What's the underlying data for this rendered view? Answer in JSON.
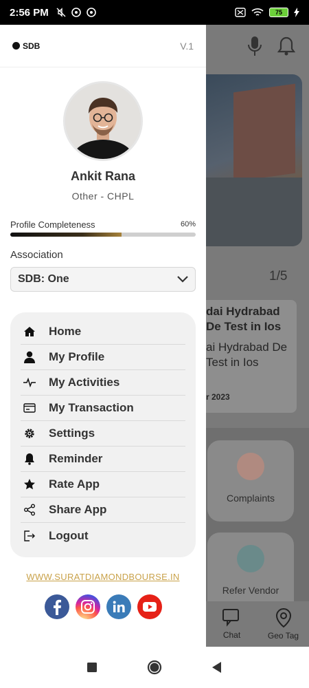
{
  "status_bar": {
    "time": "2:56 PM",
    "battery": "75"
  },
  "drawer": {
    "logo_text": "SDB",
    "version": "V.1",
    "user": {
      "name": "Ankit Rana",
      "role": "Other - CHPL"
    },
    "profile_completeness": {
      "label": "Profile Completeness",
      "percent_text": "60%",
      "value": 0.6
    },
    "association": {
      "label": "Association",
      "selected": "SDB: One"
    },
    "menu": [
      {
        "label": "Home",
        "icon": "home-icon"
      },
      {
        "label": "My Profile",
        "icon": "person-icon"
      },
      {
        "label": "My Activities",
        "icon": "activity-pulse-icon"
      },
      {
        "label": "My Transaction",
        "icon": "card-icon"
      },
      {
        "label": "Settings",
        "icon": "gear-icon"
      },
      {
        "label": "Reminder",
        "icon": "bell-icon"
      },
      {
        "label": "Rate App",
        "icon": "star-icon"
      },
      {
        "label": "Share App",
        "icon": "share-icon"
      },
      {
        "label": "Logout",
        "icon": "logout-icon"
      }
    ],
    "website": "WWW.SURATDIAMONDBOURSE.IN",
    "socials": [
      {
        "name": "facebook-icon",
        "color": "#3b5998"
      },
      {
        "name": "instagram-icon",
        "color": "#d6249f"
      },
      {
        "name": "linkedin-icon",
        "color": "#3a7bb8"
      },
      {
        "name": "youtube-icon",
        "color": "#e62117"
      }
    ]
  },
  "background_app": {
    "counter": "1/5",
    "card": {
      "title": "dai Hydrabad De Test in Ios",
      "body": "ai Hydrabad De Test in Ios",
      "date": "r 2023"
    },
    "tiles": [
      {
        "label": "Complaints"
      },
      {
        "label": "Refer Vendor"
      }
    ],
    "bottom_nav": [
      {
        "label": "Chat"
      },
      {
        "label": "Geo Tag"
      }
    ]
  }
}
